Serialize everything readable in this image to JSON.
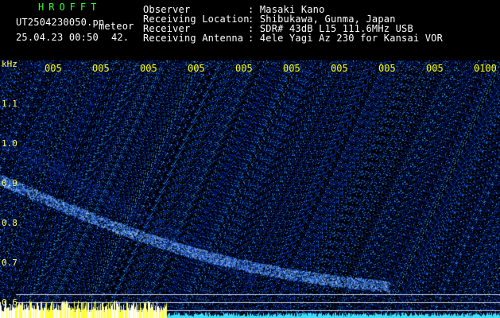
{
  "header": {
    "title": "HROFFT",
    "filename": "UT2504230050.pn",
    "filename_suffix": "meteor",
    "datetime": "25.04.23 00:50",
    "number": "42.",
    "info": [
      {
        "label": "Observer",
        "value": ": Masaki Kano"
      },
      {
        "label": "Receiving Location",
        "value": ": Shibukawa, Gunma, Japan"
      },
      {
        "label": "Receiver",
        "value": ": SDR# 43dB L15 111.6MHz USB"
      },
      {
        "label": "Receiving Antenna",
        "value": ": 4ele Yagi Az 230 for Kansai VOR"
      }
    ]
  },
  "axis": {
    "y_unit": "kHz",
    "y_ticks": [
      "1.1",
      "1.0",
      "0.9",
      "0.8",
      "0.7",
      "0.6"
    ],
    "x_ticks": [
      "005",
      "005",
      "005",
      "005",
      "005",
      "005",
      "005",
      "005",
      "005",
      "0100"
    ]
  },
  "colors": {
    "background": "#000000",
    "noise": "#1a2a9a",
    "signal": "#4aa0ff",
    "header_text": "#ffffff",
    "axis_text": "#ffff00",
    "title": "#33ff33"
  }
}
